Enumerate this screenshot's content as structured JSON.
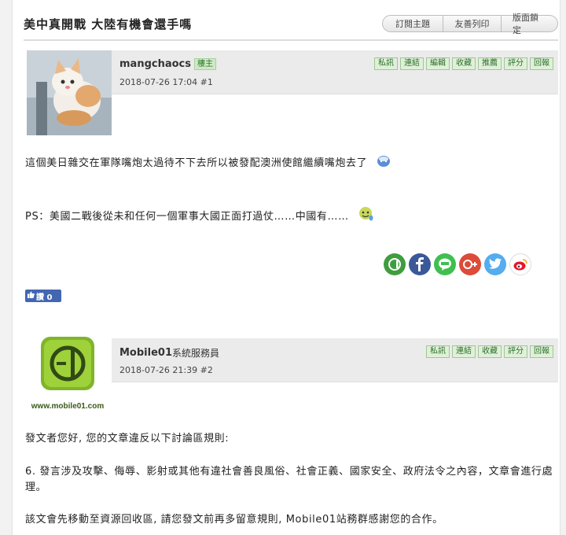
{
  "topic": {
    "title": "美中真開戰 大陸有機會還手嗎",
    "actions": [
      "訂閱主題",
      "友善列印",
      "版面鎖定"
    ]
  },
  "posts": [
    {
      "author": "mangchaocs",
      "author_suffix": "",
      "badge": "樓主",
      "meta": "2018-07-26 17:04  #1",
      "tools": [
        "私訊",
        "連結",
        "編輯",
        "收藏",
        "推薦",
        "評分",
        "回報"
      ],
      "paragraphs": [
        "這個美日雜交在軍隊嘴炮太過待不下去所以被發配澳洲使館繼續嘴炮去了",
        "PS：美國二戰後從未和任何一個軍事大國正面打過仗……中國有……"
      ],
      "emoji": [
        "sweat-smiley-icon",
        "drool-smiley-icon"
      ]
    },
    {
      "author": "Mobile01",
      "author_suffix": "系統服務員",
      "badge": "",
      "meta": "2018-07-26 21:39  #2",
      "tools": [
        "私訊",
        "連結",
        "收藏",
        "評分",
        "回報"
      ],
      "avatar_caption": "www.mobile01.com",
      "paragraphs": [
        "發文者您好, 您的文章違反以下討論區規則:",
        "6. 發言涉及攻擊、侮辱、影射或其他有違社會善良風俗、社會正義、國家安全、政府法令之內容，文章會進行處理。",
        "該文會先移動至資源回收區, 請您發文前再多留意規則, Mobile01站務群感謝您的合作。"
      ]
    }
  ],
  "share": {
    "icons": [
      "mobile01-share-icon",
      "facebook-icon",
      "line-icon",
      "google-plus-icon",
      "twitter-icon",
      "weibo-icon"
    ],
    "colors": [
      "#3f9d3f",
      "#3b5998",
      "#3fbf4f",
      "#dd4b39",
      "#55acee",
      "#ffffff"
    ]
  },
  "like": {
    "label": "讚 0"
  }
}
